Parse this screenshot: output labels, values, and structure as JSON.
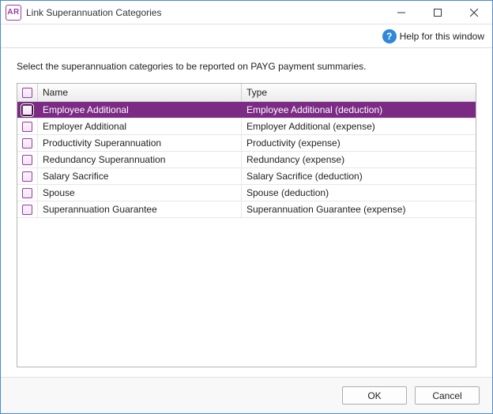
{
  "titlebar": {
    "app_badge": "AR",
    "title": "Link Superannuation Categories"
  },
  "help": {
    "label": "Help for this window",
    "glyph": "?"
  },
  "content": {
    "instruction": "Select the superannuation categories to be reported on PAYG payment summaries."
  },
  "table": {
    "header_name": "Name",
    "header_type": "Type",
    "rows": [
      {
        "name": "Employee Additional",
        "type": "Employee Additional (deduction)",
        "selected": true
      },
      {
        "name": "Employer Additional",
        "type": "Employer Additional (expense)",
        "selected": false
      },
      {
        "name": "Productivity Superannuation",
        "type": "Productivity (expense)",
        "selected": false
      },
      {
        "name": "Redundancy Superannuation",
        "type": "Redundancy (expense)",
        "selected": false
      },
      {
        "name": "Salary Sacrifice",
        "type": "Salary Sacrifice (deduction)",
        "selected": false
      },
      {
        "name": "Spouse",
        "type": "Spouse (deduction)",
        "selected": false
      },
      {
        "name": "Superannuation Guarantee",
        "type": "Superannuation Guarantee (expense)",
        "selected": false
      }
    ]
  },
  "footer": {
    "ok": "OK",
    "cancel": "Cancel"
  },
  "colors": {
    "accent": "#7c2b85",
    "titlebar_border": "#4a8bd6"
  }
}
